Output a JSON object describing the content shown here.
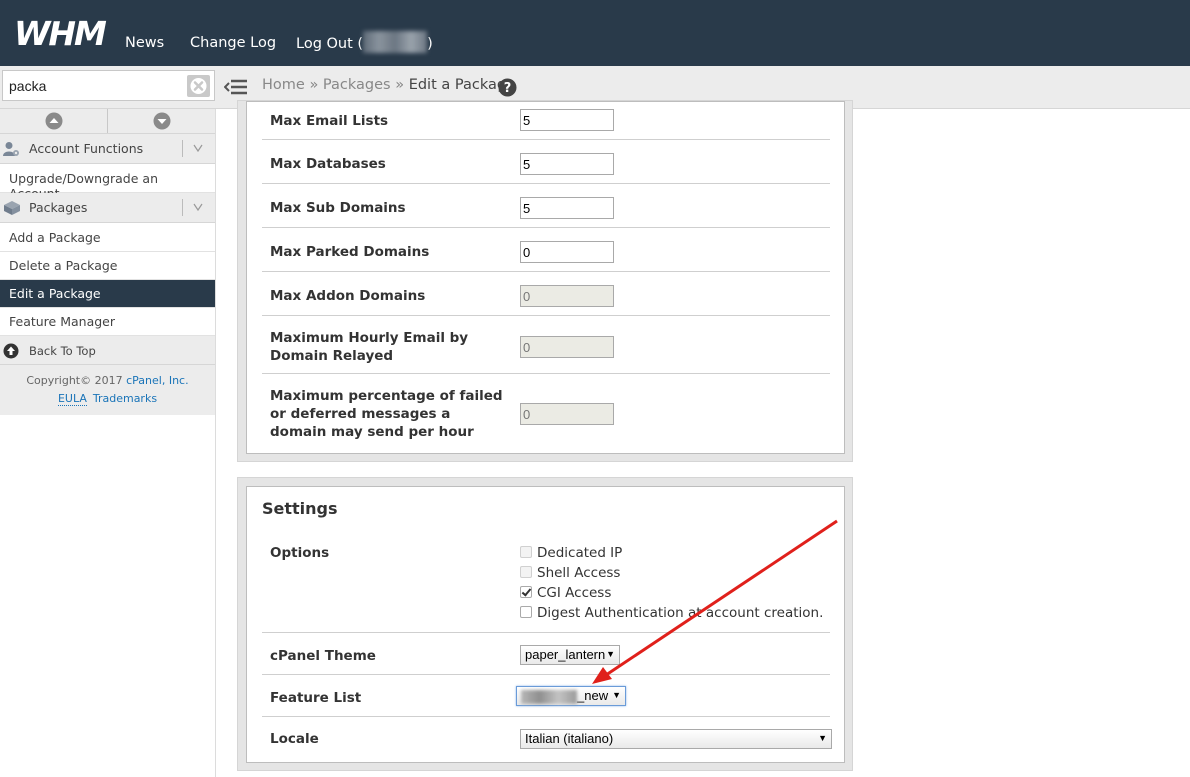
{
  "topbar": {
    "logo_text": "WHM",
    "nav": [
      "News",
      "Change Log"
    ],
    "logout_prefix": "Log Out (",
    "logout_suffix": ")"
  },
  "search": {
    "value": "packa"
  },
  "breadcrumb": {
    "home": "Home",
    "sep": "»",
    "packages": "Packages",
    "current": "Edit a Package"
  },
  "sidebar": {
    "categories": [
      {
        "label": "Account Functions",
        "icon": "user-gear-icon"
      },
      {
        "label": "Packages",
        "icon": "package-box-icon"
      }
    ],
    "account_items": [
      "Upgrade/Downgrade an Account"
    ],
    "package_items": [
      "Add a Package",
      "Delete a Package",
      "Edit a Package",
      "Feature Manager"
    ],
    "active_item": "Edit a Package",
    "back_to_top": "Back To Top",
    "copyright_text": "Copyright© 2017 ",
    "copyright_link": "cPanel, Inc.",
    "eula": "EULA",
    "trademarks": "Trademarks"
  },
  "resources": {
    "rows": [
      {
        "label": "Max Email Lists",
        "value": "5",
        "disabled": false
      },
      {
        "label": "Max Databases",
        "value": "5",
        "disabled": false
      },
      {
        "label": "Max Sub Domains",
        "value": "5",
        "disabled": false
      },
      {
        "label": "Max Parked Domains",
        "value": "0",
        "disabled": false
      },
      {
        "label": "Max Addon Domains",
        "value": "0",
        "disabled": true
      },
      {
        "label_line1": "Maximum Hourly Email by",
        "label_line2": "Domain Relayed",
        "value": "0",
        "disabled": true
      },
      {
        "label_line1": "Maximum percentage of failed",
        "label_line2": "or deferred messages a",
        "label_line3": "domain may send per hour",
        "value": "0",
        "disabled": true
      }
    ]
  },
  "settings": {
    "title": "Settings",
    "options_label": "Options",
    "options": [
      {
        "label": "Dedicated IP",
        "checked": false,
        "disabled": true
      },
      {
        "label": "Shell Access",
        "checked": false,
        "disabled": true
      },
      {
        "label": "CGI Access",
        "checked": true,
        "disabled": false
      },
      {
        "label": "Digest Authentication at account creation.",
        "checked": false,
        "disabled": false
      }
    ],
    "theme_label": "cPanel Theme",
    "theme_value": "paper_lantern",
    "feature_label": "Feature List",
    "feature_value_suffix": "_new",
    "locale_label": "Locale",
    "locale_value": "Italian (italiano)"
  },
  "colors": {
    "header_bg": "#293a4a",
    "active_bg": "#293a4a",
    "arrow": "#e0201b",
    "link": "#1a74b8"
  }
}
